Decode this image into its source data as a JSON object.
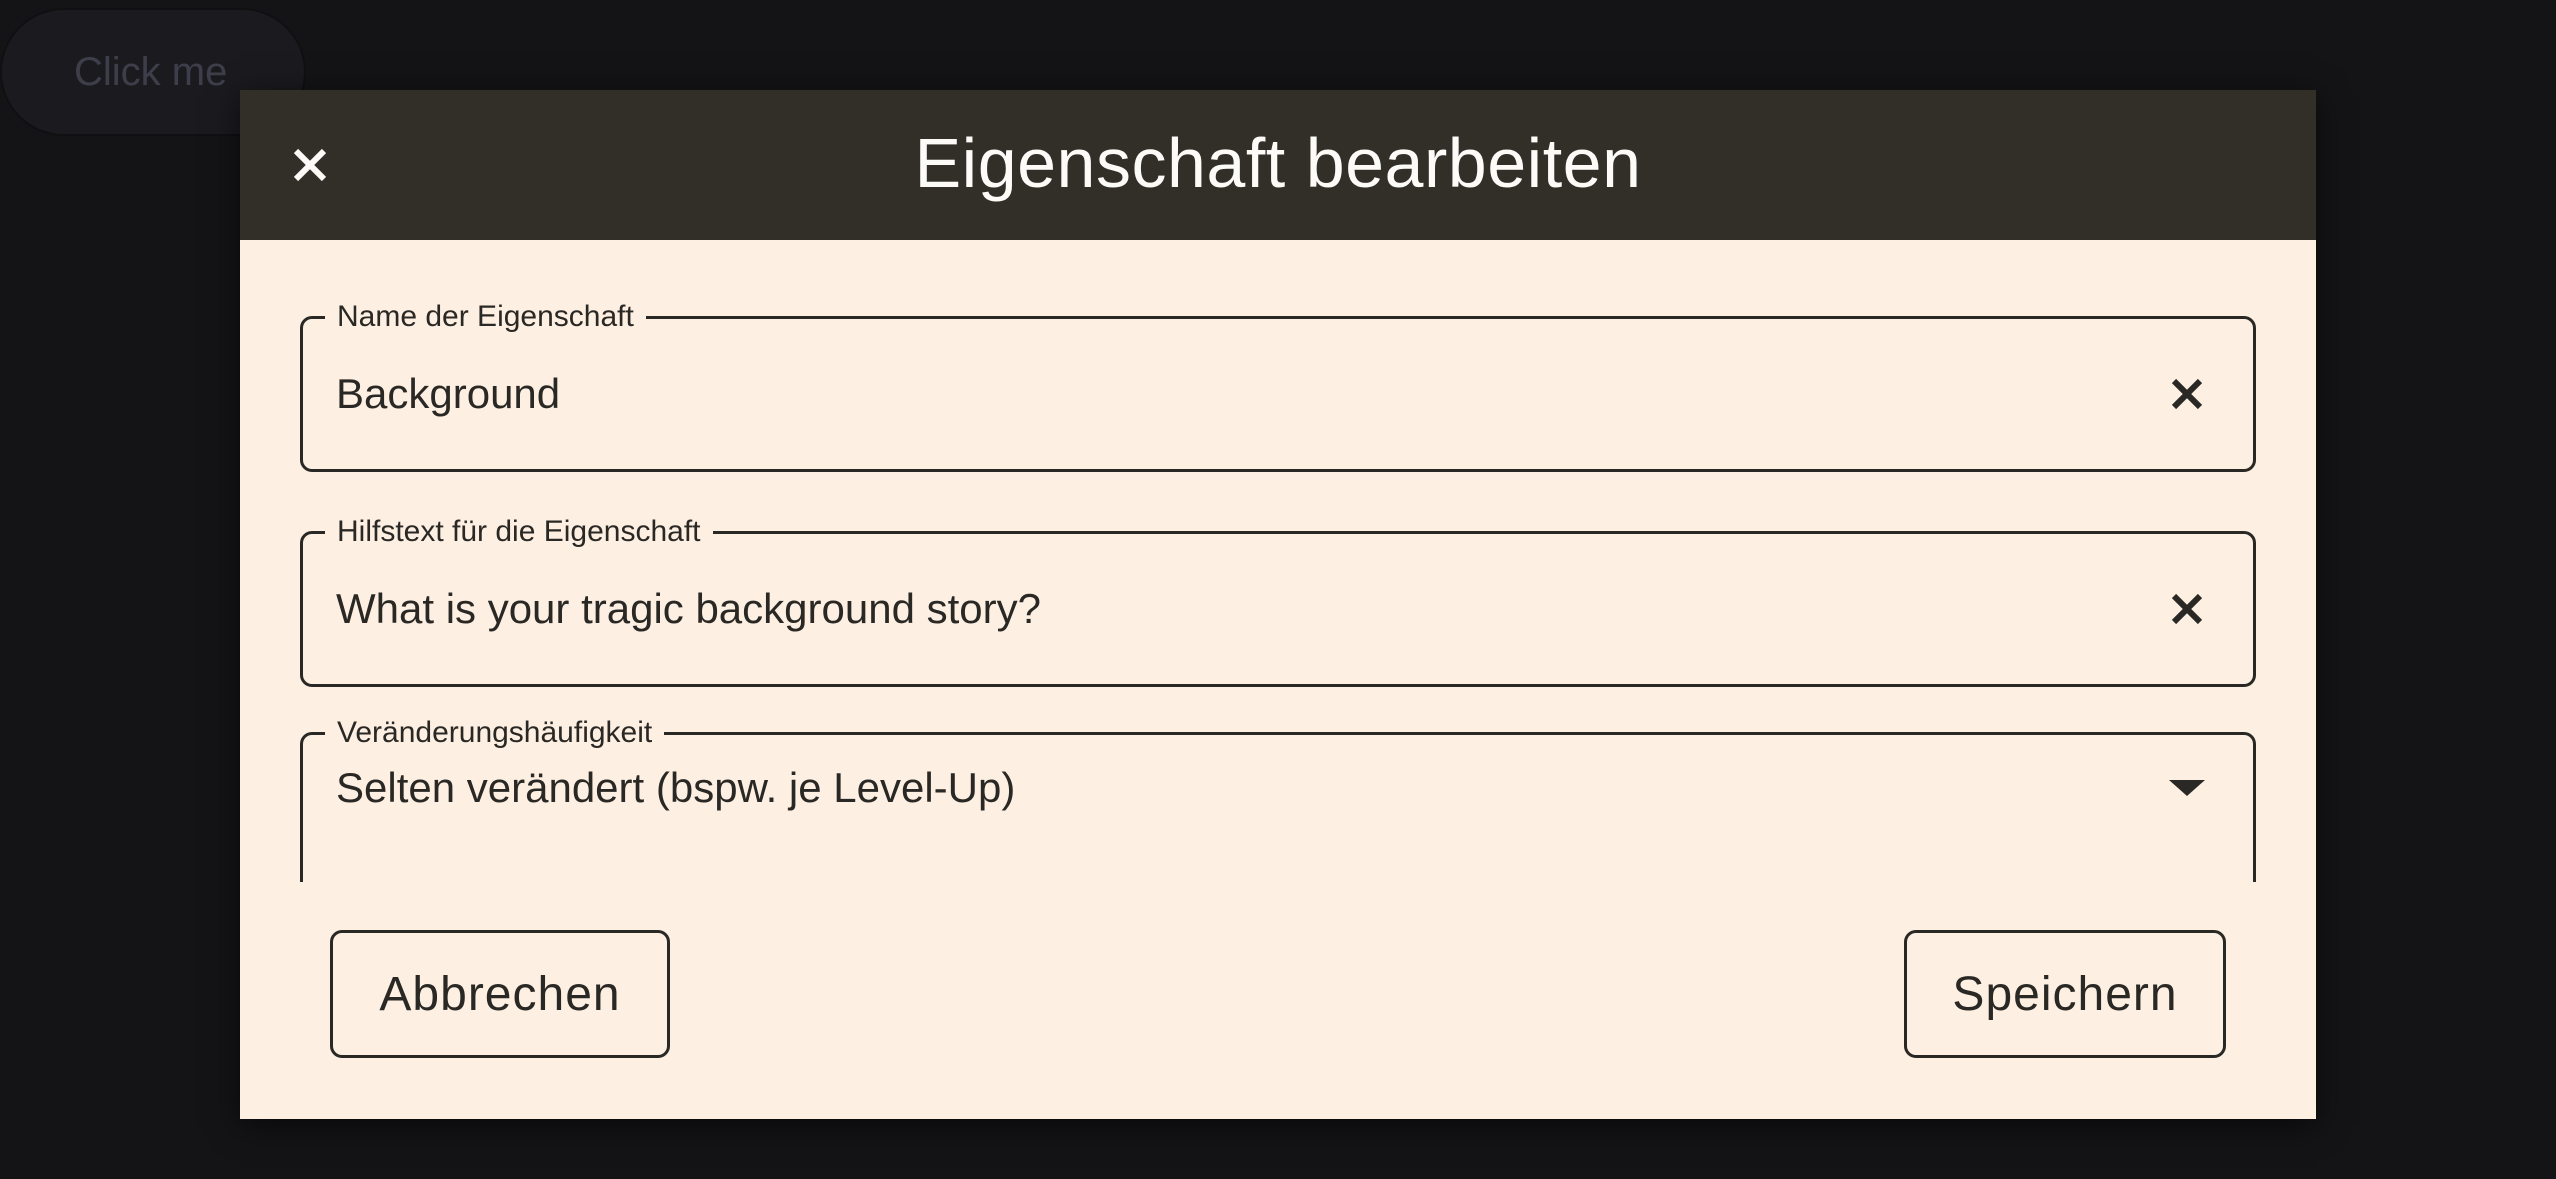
{
  "background": {
    "click_button_label": "Click me"
  },
  "dialog": {
    "title": "Eigenschaft bearbeiten",
    "close_icon": "close-icon",
    "fields": {
      "name": {
        "label": "Name der Eigenschaft",
        "value": "Background",
        "action_icon": "clear-icon"
      },
      "hint": {
        "label": "Hilfstext für die Eigenschaft",
        "value": "What is your tragic background story?",
        "action_icon": "clear-icon"
      },
      "frequency": {
        "label": "Veränderungshäufigkeit",
        "value": "Selten verändert (bspw. je Level-Up)",
        "action_icon": "dropdown-arrow-icon"
      }
    },
    "buttons": {
      "cancel": "Abbrechen",
      "save": "Speichern"
    }
  },
  "colors": {
    "page_background": "#141416",
    "dialog_background": "#fdefe2",
    "header_background": "#322f29",
    "text": "#2a2824",
    "header_text": "#fcfbf7"
  }
}
